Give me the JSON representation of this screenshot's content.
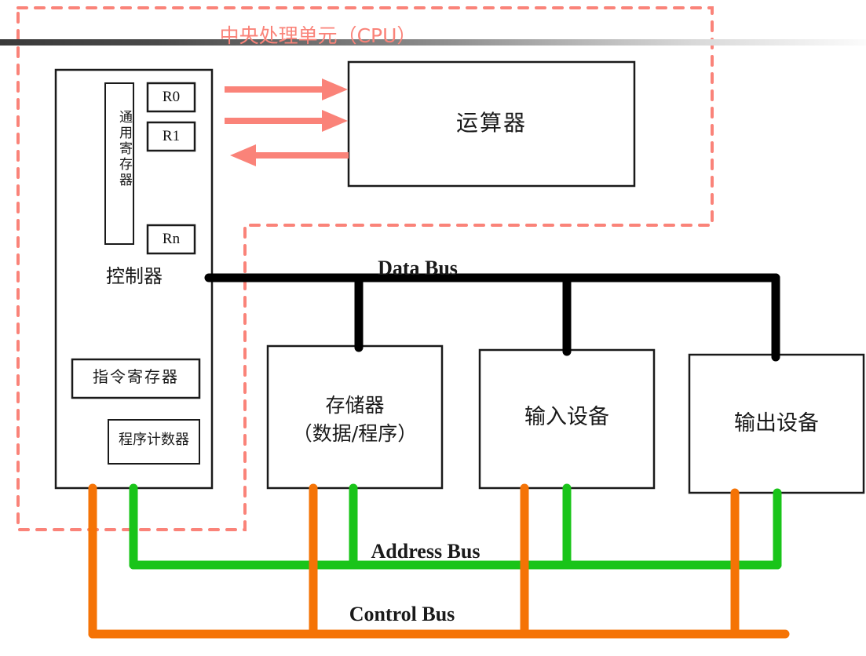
{
  "diagram": {
    "title": "中央处理单元（CPU）",
    "cpu_boundary_color": "#fa8379",
    "colors": {
      "data_bus": "#000000",
      "address_bus": "#19c419",
      "control_bus": "#f57305",
      "arrow": "#fa8379",
      "box_border": "#1a1a1a",
      "title": "#fa8379"
    }
  },
  "cpu": {
    "controller": {
      "label": "控制器",
      "register_file_label": "通用寄存器",
      "registers": [
        {
          "name": "R0"
        },
        {
          "name": "R1"
        },
        {
          "name": "Rn"
        }
      ],
      "instruction_register": "指令寄存器",
      "program_counter": "程序计数器"
    },
    "alu": {
      "label": "运算器"
    },
    "arrows": [
      {
        "direction": "right",
        "from": "controller",
        "to": "alu"
      },
      {
        "direction": "right",
        "from": "controller",
        "to": "alu"
      },
      {
        "direction": "left",
        "from": "alu",
        "to": "controller"
      }
    ]
  },
  "buses": [
    {
      "id": "data-bus",
      "label": "Data Bus",
      "color": "#000000"
    },
    {
      "id": "address-bus",
      "label": "Address Bus",
      "color": "#19c419"
    },
    {
      "id": "control-bus",
      "label": "Control Bus",
      "color": "#f57305"
    }
  ],
  "devices": [
    {
      "id": "memory",
      "line1": "存储器",
      "line2": "（数据/程序）"
    },
    {
      "id": "input-device",
      "line1": "输入设备",
      "line2": ""
    },
    {
      "id": "output-device",
      "line1": "输出设备",
      "line2": ""
    }
  ]
}
